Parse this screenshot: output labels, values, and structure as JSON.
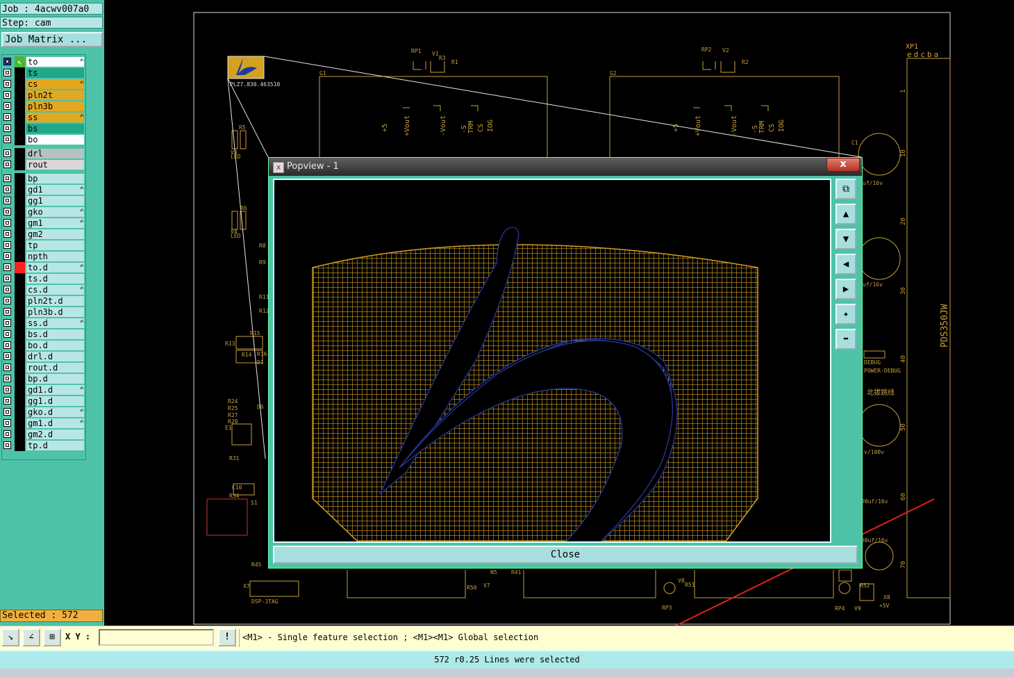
{
  "job": {
    "job_line": "Job : 4acwv007a0",
    "step_line": "Step: cam"
  },
  "job_matrix_label": "Job Matrix ...",
  "layers": [
    {
      "name": "to",
      "color": "#ffffff",
      "pen": true
    },
    {
      "name": "ts",
      "color": "#20a888"
    },
    {
      "name": "cs",
      "color": "#e2a820",
      "pen": true
    },
    {
      "name": "pln2t",
      "color": "#e2a820"
    },
    {
      "name": "pln3b",
      "color": "#e2a820"
    },
    {
      "name": "ss",
      "color": "#e2a820",
      "pen": true
    },
    {
      "name": "bs",
      "color": "#20a888"
    },
    {
      "name": "bo",
      "color": "#ffffff"
    },
    {
      "name": "drl",
      "color": "#b8c0c0"
    },
    {
      "name": "rout",
      "color": "#d8d8d8"
    },
    {
      "name": "bp",
      "color": "#b8e6e6"
    },
    {
      "name": "gd1",
      "color": "#b8e6e6",
      "pen": true
    },
    {
      "name": "gg1",
      "color": "#b8e6e6"
    },
    {
      "name": "gko",
      "color": "#b8e6e6",
      "pen": true
    },
    {
      "name": "gm1",
      "color": "#b8e6e6",
      "pen": true
    },
    {
      "name": "gm2",
      "color": "#b8e6e6"
    },
    {
      "name": "tp",
      "color": "#b8e6e6"
    },
    {
      "name": "npth",
      "color": "#b8e6e6"
    },
    {
      "name": "to.d",
      "color": "#b8e6e6",
      "pen": true,
      "marker": "red"
    },
    {
      "name": "ts.d",
      "color": "#b8e6e6"
    },
    {
      "name": "cs.d",
      "color": "#b8e6e6",
      "pen": true
    },
    {
      "name": "pln2t.d",
      "color": "#b8e6e6"
    },
    {
      "name": "pln3b.d",
      "color": "#b8e6e6"
    },
    {
      "name": "ss.d",
      "color": "#b8e6e6",
      "pen": true
    },
    {
      "name": "bs.d",
      "color": "#b8e6e6"
    },
    {
      "name": "bo.d",
      "color": "#b8e6e6"
    },
    {
      "name": "drl.d",
      "color": "#b8e6e6"
    },
    {
      "name": "rout.d",
      "color": "#b8e6e6"
    },
    {
      "name": "bp.d",
      "color": "#b8e6e6"
    },
    {
      "name": "gd1.d",
      "color": "#b8e6e6",
      "pen": true
    },
    {
      "name": "gg1.d",
      "color": "#b8e6e6"
    },
    {
      "name": "gko.d",
      "color": "#b8e6e6",
      "pen": true
    },
    {
      "name": "gm1.d",
      "color": "#b8e6e6",
      "pen": true
    },
    {
      "name": "gm2.d",
      "color": "#b8e6e6"
    },
    {
      "name": "tp.d",
      "color": "#b8e6e6"
    }
  ],
  "selected_label": "Selected : 572",
  "board": {
    "logo_label": "PLZ7.830.463510",
    "refdes": [
      "RP1",
      "V1",
      "R3",
      "R1",
      "RP2",
      "V2",
      "R2",
      "R3",
      "XP1",
      "G1",
      "G2",
      "C1",
      "R5",
      "V3",
      "LED",
      "V4",
      "LED",
      "R6",
      "R8",
      "R9",
      "R11",
      "R12",
      "R13",
      "R14",
      "R15",
      "R16",
      "D1",
      "R24",
      "R25",
      "R27",
      "R29",
      "D6",
      "E1",
      "R31",
      "C10",
      "R34",
      "S1",
      "R45",
      "X7",
      "DSP-JTAG",
      "R50",
      "V7",
      "R41",
      "N5",
      "V8",
      "R51",
      "RP3",
      "V9",
      "R52",
      "RP4",
      "X8",
      "+5V",
      "DEBUG",
      "POWER-DEBUG"
    ],
    "labels_rot": [
      "+5",
      "+Vout",
      "-Vout",
      "-S",
      "TRM",
      "CS",
      "IOG",
      "+5",
      "+Vout",
      "-Vout",
      "-S",
      "TRM",
      "CS",
      "IOG"
    ],
    "xp1_pins": "edcba",
    "pin_numbers": [
      "1",
      "10",
      "20",
      "30",
      "40",
      "50",
      "60",
      "70"
    ],
    "cap_labels": [
      "uf/16v",
      "uf/16v",
      "v/100v",
      "00uf/16v",
      "00uf/16v"
    ],
    "connector_name": "PDS350JW",
    "chinese_label": "北拔跳线"
  },
  "popview": {
    "title": "Popview - 1",
    "close_x": "x",
    "close_button": "Close",
    "tools": [
      "zoom-fit",
      "view-top",
      "view-bottom",
      "view-left",
      "view-right",
      "zoom-in",
      "zoom-out"
    ]
  },
  "bottom": {
    "xy_label": "X Y :",
    "xy_value": "",
    "alert_glyph": "!",
    "hint": "<M1> - Single feature selection ; <M1><M1> Global selection"
  },
  "status": "572 r0.25 Lines were selected",
  "colors": {
    "copper": "#d4a020",
    "panel": "#4ec3a8",
    "arrow": "#e02020"
  }
}
